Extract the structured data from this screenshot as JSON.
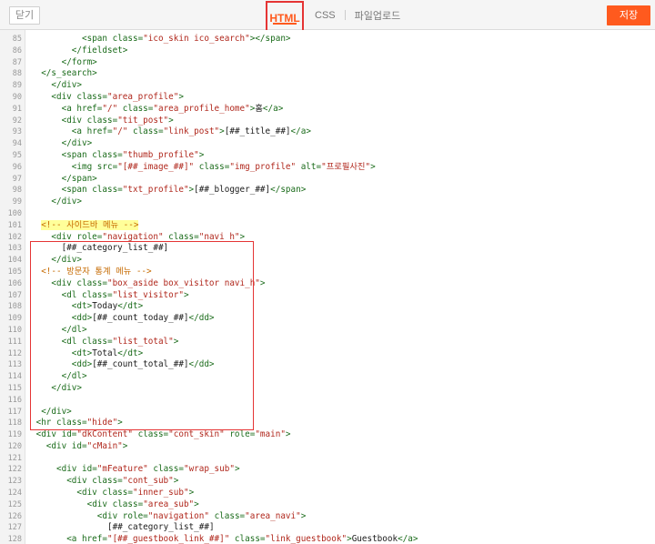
{
  "toolbar": {
    "close_label": "닫기",
    "tabs": [
      {
        "label": "HTML",
        "active": true
      },
      {
        "label": "CSS",
        "active": false
      },
      {
        "label": "파일업로드",
        "active": false
      }
    ],
    "save_label": "저장"
  },
  "colors": {
    "accent": "#ff5a1e",
    "highlight_box": "#e53434",
    "comment_highlight": "#ffff9a"
  },
  "editor": {
    "lines": [
      {
        "n": "85",
        "indent": 10,
        "tokens": [
          [
            "t",
            "<span "
          ],
          [
            "a",
            "class="
          ],
          [
            "s",
            "\"ico_skin ico_search\""
          ],
          [
            "t",
            "></span>"
          ]
        ]
      },
      {
        "n": "86",
        "indent": 8,
        "tokens": [
          [
            "t",
            "</fieldset>"
          ]
        ]
      },
      {
        "n": "87",
        "indent": 6,
        "tokens": [
          [
            "t",
            "</form>"
          ]
        ]
      },
      {
        "n": "88",
        "indent": 2,
        "tokens": [
          [
            "t",
            "</s_search>"
          ]
        ]
      },
      {
        "n": "89",
        "indent": 4,
        "tokens": [
          [
            "t",
            "</div>"
          ]
        ]
      },
      {
        "n": "90",
        "indent": 4,
        "tokens": [
          [
            "t",
            "<div "
          ],
          [
            "a",
            "class="
          ],
          [
            "s",
            "\"area_profile\""
          ],
          [
            "t",
            ">"
          ]
        ]
      },
      {
        "n": "91",
        "indent": 6,
        "tokens": [
          [
            "t",
            "<a "
          ],
          [
            "a",
            "href="
          ],
          [
            "s",
            "\"/\""
          ],
          [
            "a",
            " class="
          ],
          [
            "s",
            "\"area_profile_home\""
          ],
          [
            "t",
            ">"
          ],
          [
            "p",
            "홈"
          ],
          [
            "t",
            "</a>"
          ]
        ]
      },
      {
        "n": "92",
        "indent": 6,
        "tokens": [
          [
            "t",
            "<div "
          ],
          [
            "a",
            "class="
          ],
          [
            "s",
            "\"tit_post\""
          ],
          [
            "t",
            ">"
          ]
        ]
      },
      {
        "n": "93",
        "indent": 8,
        "tokens": [
          [
            "t",
            "<a "
          ],
          [
            "a",
            "href="
          ],
          [
            "s",
            "\"/\""
          ],
          [
            "a",
            " class="
          ],
          [
            "s",
            "\"link_post\""
          ],
          [
            "t",
            ">"
          ],
          [
            "p",
            "[##_title_##]"
          ],
          [
            "t",
            "</a>"
          ]
        ]
      },
      {
        "n": "94",
        "indent": 6,
        "tokens": [
          [
            "t",
            "</div>"
          ]
        ]
      },
      {
        "n": "95",
        "indent": 6,
        "tokens": [
          [
            "t",
            "<span "
          ],
          [
            "a",
            "class="
          ],
          [
            "s",
            "\"thumb_profile\""
          ],
          [
            "t",
            ">"
          ]
        ]
      },
      {
        "n": "96",
        "indent": 8,
        "tokens": [
          [
            "t",
            "<img "
          ],
          [
            "a",
            "src="
          ],
          [
            "s",
            "\"[##_image_##]\""
          ],
          [
            "a",
            " class="
          ],
          [
            "s",
            "\"img_profile\""
          ],
          [
            "a",
            " alt="
          ],
          [
            "s",
            "\"프로필사진\""
          ],
          [
            "t",
            ">"
          ]
        ]
      },
      {
        "n": "97",
        "indent": 6,
        "tokens": [
          [
            "t",
            "</span>"
          ]
        ]
      },
      {
        "n": "98",
        "indent": 6,
        "tokens": [
          [
            "t",
            "<span "
          ],
          [
            "a",
            "class="
          ],
          [
            "s",
            "\"txt_profile\""
          ],
          [
            "t",
            ">"
          ],
          [
            "p",
            "[##_blogger_##]"
          ],
          [
            "t",
            "</span>"
          ]
        ]
      },
      {
        "n": "99",
        "indent": 4,
        "tokens": [
          [
            "t",
            "</div>"
          ]
        ]
      },
      {
        "n": "100",
        "indent": 0,
        "tokens": []
      },
      {
        "n": "101",
        "indent": 2,
        "tokens": [
          [
            "ch",
            "<!-- 사이드바 메뉴 -->"
          ]
        ]
      },
      {
        "n": "102",
        "indent": 4,
        "tokens": [
          [
            "t",
            "<div "
          ],
          [
            "a",
            "role="
          ],
          [
            "s",
            "\"navigation\""
          ],
          [
            "a",
            " class="
          ],
          [
            "s",
            "\"navi_h\""
          ],
          [
            "t",
            ">"
          ]
        ]
      },
      {
        "n": "103",
        "indent": 6,
        "tokens": [
          [
            "p",
            "[##_category_list_##]"
          ]
        ]
      },
      {
        "n": "104",
        "indent": 4,
        "tokens": [
          [
            "t",
            "</div>"
          ]
        ]
      },
      {
        "n": "105",
        "indent": 2,
        "tokens": [
          [
            "c",
            "<!-- 방문자 통계 메뉴 -->"
          ]
        ]
      },
      {
        "n": "106",
        "indent": 4,
        "tokens": [
          [
            "t",
            "<div "
          ],
          [
            "a",
            "class="
          ],
          [
            "s",
            "\"box_aside box_visitor navi_h\""
          ],
          [
            "t",
            ">"
          ]
        ]
      },
      {
        "n": "107",
        "indent": 6,
        "tokens": [
          [
            "t",
            "<dl "
          ],
          [
            "a",
            "class="
          ],
          [
            "s",
            "\"list_visitor\""
          ],
          [
            "t",
            ">"
          ]
        ]
      },
      {
        "n": "108",
        "indent": 8,
        "tokens": [
          [
            "t",
            "<dt>"
          ],
          [
            "p",
            "Today"
          ],
          [
            "t",
            "</dt>"
          ]
        ]
      },
      {
        "n": "109",
        "indent": 8,
        "tokens": [
          [
            "t",
            "<dd>"
          ],
          [
            "p",
            "[##_count_today_##]"
          ],
          [
            "t",
            "</dd>"
          ]
        ]
      },
      {
        "n": "110",
        "indent": 6,
        "tokens": [
          [
            "t",
            "</dl>"
          ]
        ]
      },
      {
        "n": "111",
        "indent": 6,
        "tokens": [
          [
            "t",
            "<dl "
          ],
          [
            "a",
            "class="
          ],
          [
            "s",
            "\"list_total\""
          ],
          [
            "t",
            ">"
          ]
        ]
      },
      {
        "n": "112",
        "indent": 8,
        "tokens": [
          [
            "t",
            "<dt>"
          ],
          [
            "p",
            "Total"
          ],
          [
            "t",
            "</dt>"
          ]
        ]
      },
      {
        "n": "113",
        "indent": 8,
        "tokens": [
          [
            "t",
            "<dd>"
          ],
          [
            "p",
            "[##_count_total_##]"
          ],
          [
            "t",
            "</dd>"
          ]
        ]
      },
      {
        "n": "114",
        "indent": 6,
        "tokens": [
          [
            "t",
            "</dl>"
          ]
        ]
      },
      {
        "n": "115",
        "indent": 4,
        "tokens": [
          [
            "t",
            "</div>"
          ]
        ]
      },
      {
        "n": "116",
        "indent": 0,
        "tokens": []
      },
      {
        "n": "117",
        "indent": 2,
        "tokens": [
          [
            "t",
            "</div>"
          ]
        ]
      },
      {
        "n": "118",
        "indent": 1,
        "tokens": [
          [
            "t",
            "<hr "
          ],
          [
            "a",
            "class="
          ],
          [
            "s",
            "\"hide\""
          ],
          [
            "t",
            ">"
          ]
        ]
      },
      {
        "n": "119",
        "indent": 1,
        "tokens": [
          [
            "t",
            "<div "
          ],
          [
            "a",
            "id="
          ],
          [
            "s",
            "\"dkContent\""
          ],
          [
            "a",
            " class="
          ],
          [
            "s",
            "\"cont_skin\""
          ],
          [
            "a",
            " role="
          ],
          [
            "s",
            "\"main\""
          ],
          [
            "t",
            ">"
          ]
        ]
      },
      {
        "n": "120",
        "indent": 3,
        "tokens": [
          [
            "t",
            "<div "
          ],
          [
            "a",
            "id="
          ],
          [
            "s",
            "\"cMain\""
          ],
          [
            "t",
            ">"
          ]
        ]
      },
      {
        "n": "121",
        "indent": 0,
        "tokens": []
      },
      {
        "n": "122",
        "indent": 5,
        "tokens": [
          [
            "t",
            "<div "
          ],
          [
            "a",
            "id="
          ],
          [
            "s",
            "\"mFeature\""
          ],
          [
            "a",
            " class="
          ],
          [
            "s",
            "\"wrap_sub\""
          ],
          [
            "t",
            ">"
          ]
        ]
      },
      {
        "n": "123",
        "indent": 7,
        "tokens": [
          [
            "t",
            "<div "
          ],
          [
            "a",
            "class="
          ],
          [
            "s",
            "\"cont_sub\""
          ],
          [
            "t",
            ">"
          ]
        ]
      },
      {
        "n": "124",
        "indent": 9,
        "tokens": [
          [
            "t",
            "<div "
          ],
          [
            "a",
            "class="
          ],
          [
            "s",
            "\"inner_sub\""
          ],
          [
            "t",
            ">"
          ]
        ]
      },
      {
        "n": "125",
        "indent": 11,
        "tokens": [
          [
            "t",
            "<div "
          ],
          [
            "a",
            "class="
          ],
          [
            "s",
            "\"area_sub\""
          ],
          [
            "t",
            ">"
          ]
        ]
      },
      {
        "n": "126",
        "indent": 13,
        "tokens": [
          [
            "t",
            "<div "
          ],
          [
            "a",
            "role="
          ],
          [
            "s",
            "\"navigation\""
          ],
          [
            "a",
            " class="
          ],
          [
            "s",
            "\"area_navi\""
          ],
          [
            "t",
            ">"
          ]
        ]
      },
      {
        "n": "127",
        "indent": 15,
        "tokens": [
          [
            "p",
            "[##_category_list_##]"
          ]
        ]
      },
      {
        "n": "128",
        "indent": 7,
        "tokens": [
          [
            "t",
            "<a "
          ],
          [
            "a",
            "href="
          ],
          [
            "s",
            "\"[##_guestbook_link_##]\""
          ],
          [
            "a",
            " class="
          ],
          [
            "s",
            "\"link_guestbook\""
          ],
          [
            "t",
            ">"
          ],
          [
            "p",
            "Guestbook"
          ],
          [
            "t",
            "</a>"
          ]
        ]
      }
    ]
  }
}
